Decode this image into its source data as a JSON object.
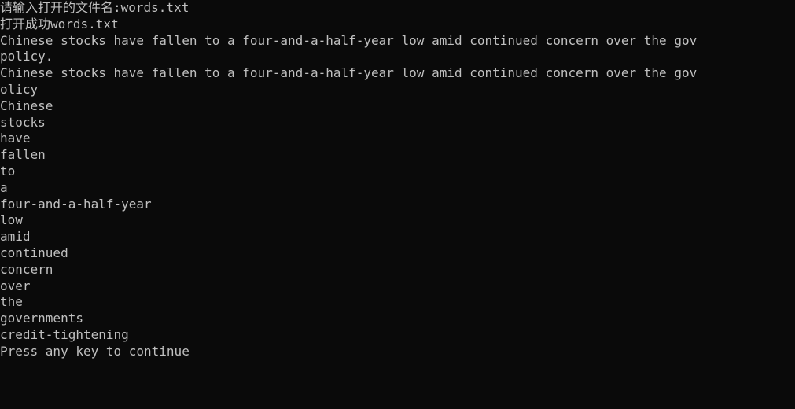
{
  "terminal": {
    "lines": [
      "请输入打开的文件名:words.txt",
      "打开成功words.txt",
      "Chinese stocks have fallen to a four-and-a-half-year low amid continued concern over the gov",
      "policy.",
      "Chinese stocks have fallen to a four-and-a-half-year low amid continued concern over the gov",
      "olicy",
      "Chinese",
      "stocks",
      "have",
      "fallen",
      "to",
      "a",
      "four-and-a-half-year",
      "low",
      "amid",
      "continued",
      "concern",
      "over",
      "the",
      "governments",
      "credit-tightening",
      "Press any key to continue"
    ]
  }
}
